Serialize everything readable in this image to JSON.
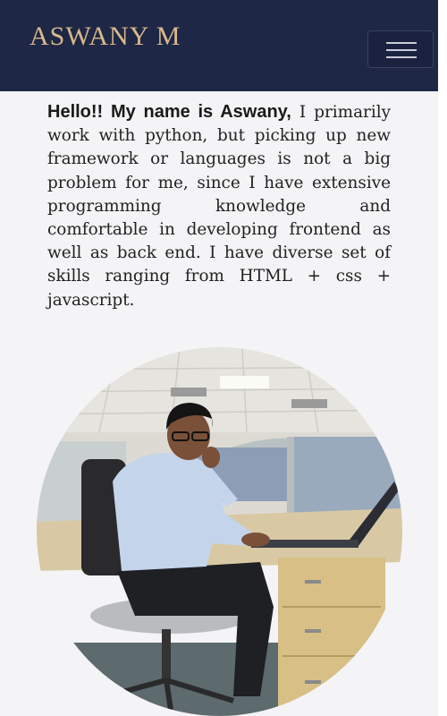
{
  "navbar": {
    "brand": "ASWANY M",
    "toggle_icon": "hamburger-menu-icon"
  },
  "intro": {
    "lead": "Hello!! My name is Aswany,",
    "body": " I primarily work with python, but picking up new framework or languages is not a big problem for me, since I have extensive programming knowledge and comfortable in developing frontend as well as back end. I have diverse set of skills ranging from HTML + css + javascript."
  },
  "photo": {
    "subject": "profile-photo"
  },
  "colors": {
    "navbar_bg": "#1f2746",
    "brand": "#d8b98a",
    "page_bg": "#f4f4f6",
    "text": "#222222"
  }
}
